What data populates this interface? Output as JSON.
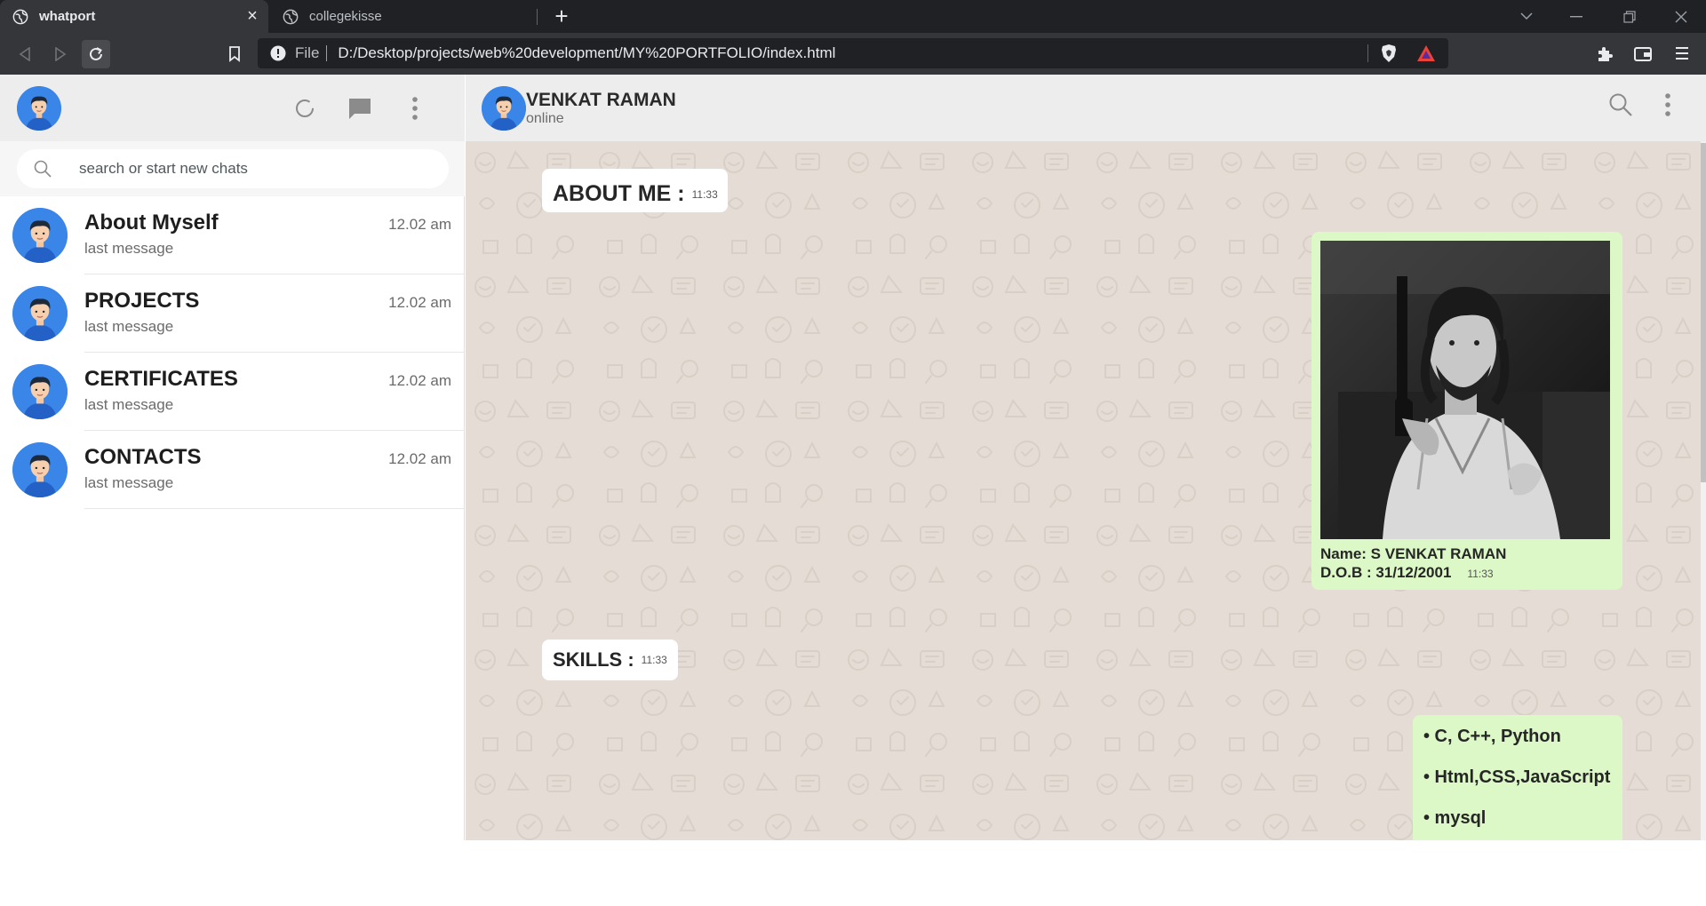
{
  "browser": {
    "tabs": [
      {
        "title": "whatport",
        "active": true
      },
      {
        "title": "collegekisse",
        "active": false
      }
    ],
    "address": {
      "scheme": "File",
      "url": "D:/Desktop/projects/web%20development/MY%20PORTFOLIO/index.html"
    }
  },
  "sidebar": {
    "search_placeholder": "search or start new chats",
    "chats": [
      {
        "name": "About Myself",
        "last_message": "last message",
        "time": "12.02 am"
      },
      {
        "name": "PROJECTS",
        "last_message": "last message",
        "time": "12.02 am"
      },
      {
        "name": "CERTIFICATES",
        "last_message": "last message",
        "time": "12.02 am"
      },
      {
        "name": "CONTACTS",
        "last_message": "last message",
        "time": "12.02 am"
      }
    ]
  },
  "conversation": {
    "contact_name": "VENKAT RAMAN",
    "status": "online",
    "messages": {
      "about": {
        "text": "ABOUT ME :",
        "time": "11:33"
      },
      "profile": {
        "name_line": "Name: S VENKAT RAMAN",
        "dob_line": "D.O.B : 31/12/2001",
        "time": "11:33"
      },
      "skills": {
        "text": "SKILLS :",
        "time": "11:33"
      },
      "skill_items": [
        "• C, C++, Python",
        "• Html,CSS,JavaScript",
        "• mysql"
      ]
    }
  },
  "colors": {
    "wallpaper": "#e5ddd5",
    "outgoing_bubble": "#dcf8c6",
    "incoming_bubble": "#ffffff",
    "header": "#ededed",
    "avatar_blue": "#3a86e8"
  }
}
